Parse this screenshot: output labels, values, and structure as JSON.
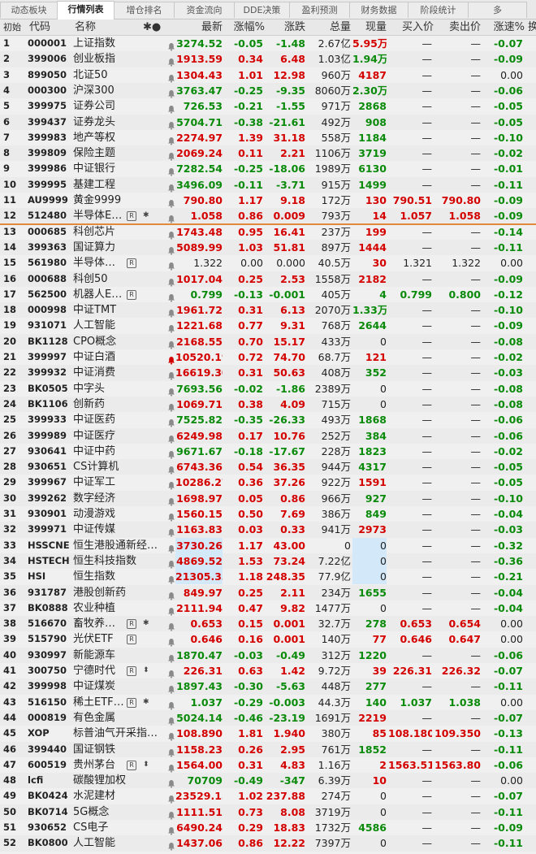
{
  "tabs": [
    "动态板块",
    "行情列表",
    "增仓排名",
    "资金流向",
    "DDE决策",
    "盈利预测",
    "财务数据",
    "阶段统计",
    "多"
  ],
  "active_tab": 1,
  "columns": [
    "初始",
    "代码",
    "名称",
    "✱●",
    "最新",
    "涨幅%",
    "涨跌",
    "总量",
    "现量",
    "买入价",
    "卖出价",
    "涨速%",
    "换"
  ],
  "colors": {
    "up": "#d40000",
    "down": "#0a8a0a",
    "separator": "#e08a3a",
    "highlight": "#d3e8f8"
  },
  "rows": [
    {
      "n": "1",
      "code": "000001",
      "name": "上证指数",
      "last": "3274.52",
      "pct": "-0.05",
      "chg": "-1.48",
      "vol": "2.67亿",
      "cur": "5.95万",
      "bid": "—",
      "ask": "—",
      "spd": "-0.07",
      "dir": "dn",
      "cur_dir": "up",
      "spd_dir": "dn"
    },
    {
      "n": "2",
      "code": "399006",
      "name": "创业板指",
      "last": "1913.59",
      "pct": "0.34",
      "chg": "6.48",
      "vol": "1.03亿",
      "cur": "1.94万",
      "bid": "—",
      "ask": "—",
      "spd": "-0.09",
      "dir": "up",
      "cur_dir": "dn",
      "spd_dir": "dn"
    },
    {
      "n": "3",
      "code": "899050",
      "name": "北证50",
      "last": "1304.43",
      "pct": "1.01",
      "chg": "12.98",
      "vol": "960万",
      "cur": "4187",
      "bid": "—",
      "ask": "—",
      "spd": "0.00",
      "dir": "up",
      "cur_dir": "up",
      "spd_dir": "flat"
    },
    {
      "n": "4",
      "code": "000300",
      "name": "沪深300",
      "last": "3763.47",
      "pct": "-0.25",
      "chg": "-9.35",
      "vol": "8060万",
      "cur": "2.30万",
      "bid": "—",
      "ask": "—",
      "spd": "-0.06",
      "dir": "dn",
      "cur_dir": "dn",
      "spd_dir": "dn"
    },
    {
      "n": "5",
      "code": "399975",
      "name": "证券公司",
      "last": "726.53",
      "pct": "-0.21",
      "chg": "-1.55",
      "vol": "971万",
      "cur": "2868",
      "bid": "—",
      "ask": "—",
      "spd": "-0.05",
      "dir": "dn",
      "cur_dir": "dn",
      "spd_dir": "dn"
    },
    {
      "n": "6",
      "code": "399437",
      "name": "证券龙头",
      "last": "5704.71",
      "pct": "-0.38",
      "chg": "-21.61",
      "vol": "492万",
      "cur": "908",
      "bid": "—",
      "ask": "—",
      "spd": "-0.05",
      "dir": "dn",
      "cur_dir": "dn",
      "spd_dir": "dn"
    },
    {
      "n": "7",
      "code": "399983",
      "name": "地产等权",
      "last": "2274.97",
      "pct": "1.39",
      "chg": "31.18",
      "vol": "558万",
      "cur": "1184",
      "bid": "—",
      "ask": "—",
      "spd": "-0.10",
      "dir": "up",
      "cur_dir": "dn",
      "spd_dir": "dn"
    },
    {
      "n": "8",
      "code": "399809",
      "name": "保险主题",
      "last": "2069.24",
      "pct": "0.11",
      "chg": "2.21",
      "vol": "1106万",
      "cur": "3719",
      "bid": "—",
      "ask": "—",
      "spd": "-0.02",
      "dir": "up",
      "cur_dir": "dn",
      "spd_dir": "dn"
    },
    {
      "n": "9",
      "code": "399986",
      "name": "中证银行",
      "last": "7282.54",
      "pct": "-0.25",
      "chg": "-18.06",
      "vol": "1989万",
      "cur": "6130",
      "bid": "—",
      "ask": "—",
      "spd": "-0.01",
      "dir": "dn",
      "cur_dir": "dn",
      "spd_dir": "dn"
    },
    {
      "n": "10",
      "code": "399995",
      "name": "基建工程",
      "last": "3496.09",
      "pct": "-0.11",
      "chg": "-3.71",
      "vol": "915万",
      "cur": "1499",
      "bid": "—",
      "ask": "—",
      "spd": "-0.11",
      "dir": "dn",
      "cur_dir": "dn",
      "spd_dir": "dn"
    },
    {
      "n": "11",
      "code": "AU9999",
      "name": "黄金9999",
      "last": "790.80",
      "pct": "1.17",
      "chg": "9.18",
      "vol": "172万",
      "cur": "130",
      "bid": "790.51",
      "ask": "790.80",
      "spd": "-0.09",
      "dir": "up",
      "cur_dir": "up",
      "spd_dir": "dn"
    },
    {
      "n": "12",
      "code": "512480",
      "name": "半导体E…",
      "last": "1.058",
      "pct": "0.86",
      "chg": "0.009",
      "vol": "793万",
      "cur": "14",
      "bid": "1.057",
      "ask": "1.058",
      "spd": "-0.09",
      "dir": "up",
      "cur_dir": "up",
      "spd_dir": "dn",
      "badge": "R",
      "mark": "✱"
    },
    {
      "n": "13",
      "code": "000685",
      "name": "科创芯片",
      "last": "1743.48",
      "pct": "0.95",
      "chg": "16.41",
      "vol": "237万",
      "cur": "199",
      "bid": "—",
      "ask": "—",
      "spd": "-0.14",
      "dir": "up",
      "cur_dir": "up",
      "spd_dir": "dn"
    },
    {
      "n": "14",
      "code": "399363",
      "name": "国证算力",
      "last": "5089.99",
      "pct": "1.03",
      "chg": "51.81",
      "vol": "897万",
      "cur": "1444",
      "bid": "—",
      "ask": "—",
      "spd": "-0.11",
      "dir": "up",
      "cur_dir": "up",
      "spd_dir": "dn"
    },
    {
      "n": "15",
      "code": "561980",
      "name": "半导体…",
      "last": "1.322",
      "pct": "0.00",
      "chg": "0.000",
      "vol": "40.5万",
      "cur": "30",
      "bid": "1.321",
      "ask": "1.322",
      "spd": "0.00",
      "dir": "flat",
      "cur_dir": "up",
      "spd_dir": "flat",
      "badge": "R"
    },
    {
      "n": "16",
      "code": "000688",
      "name": "科创50",
      "last": "1017.04",
      "pct": "0.25",
      "chg": "2.53",
      "vol": "1558万",
      "cur": "2182",
      "bid": "—",
      "ask": "—",
      "spd": "-0.09",
      "dir": "up",
      "cur_dir": "up",
      "spd_dir": "dn"
    },
    {
      "n": "17",
      "code": "562500",
      "name": "机器人E…",
      "last": "0.799",
      "pct": "-0.13",
      "chg": "-0.001",
      "vol": "405万",
      "cur": "4",
      "bid": "0.799",
      "ask": "0.800",
      "spd": "-0.12",
      "dir": "dn",
      "cur_dir": "dn",
      "spd_dir": "dn",
      "badge": "R"
    },
    {
      "n": "18",
      "code": "000998",
      "name": "中证TMT",
      "last": "1961.72",
      "pct": "0.31",
      "chg": "6.13",
      "vol": "2070万",
      "cur": "1.33万",
      "bid": "—",
      "ask": "—",
      "spd": "-0.10",
      "dir": "up",
      "cur_dir": "dn",
      "spd_dir": "dn"
    },
    {
      "n": "19",
      "code": "931071",
      "name": "人工智能",
      "last": "1221.68",
      "pct": "0.77",
      "chg": "9.31",
      "vol": "768万",
      "cur": "2644",
      "bid": "—",
      "ask": "—",
      "spd": "-0.09",
      "dir": "up",
      "cur_dir": "dn",
      "spd_dir": "dn"
    },
    {
      "n": "20",
      "code": "BK1128",
      "name": "CPO概念",
      "last": "2168.55",
      "pct": "0.70",
      "chg": "15.17",
      "vol": "433万",
      "cur": "0",
      "bid": "—",
      "ask": "—",
      "spd": "-0.08",
      "dir": "up",
      "cur_dir": "flat",
      "spd_dir": "dn"
    },
    {
      "n": "21",
      "code": "399997",
      "name": "中证白酒",
      "last": "10520.19",
      "pct": "0.72",
      "chg": "74.70",
      "vol": "68.7万",
      "cur": "121",
      "bid": "—",
      "ask": "—",
      "spd": "-0.02",
      "dir": "up",
      "cur_dir": "up",
      "spd_dir": "dn",
      "bell_red": true
    },
    {
      "n": "22",
      "code": "399932",
      "name": "中证消费",
      "last": "16619.30",
      "pct": "0.31",
      "chg": "50.63",
      "vol": "408万",
      "cur": "352",
      "bid": "—",
      "ask": "—",
      "spd": "-0.03",
      "dir": "up",
      "cur_dir": "dn",
      "spd_dir": "dn"
    },
    {
      "n": "23",
      "code": "BK0505",
      "name": "中字头",
      "last": "7693.56",
      "pct": "-0.02",
      "chg": "-1.86",
      "vol": "2389万",
      "cur": "0",
      "bid": "—",
      "ask": "—",
      "spd": "-0.08",
      "dir": "dn",
      "cur_dir": "flat",
      "spd_dir": "dn"
    },
    {
      "n": "24",
      "code": "BK1106",
      "name": "创新药",
      "last": "1069.71",
      "pct": "0.38",
      "chg": "4.09",
      "vol": "715万",
      "cur": "0",
      "bid": "—",
      "ask": "—",
      "spd": "-0.08",
      "dir": "up",
      "cur_dir": "flat",
      "spd_dir": "dn"
    },
    {
      "n": "25",
      "code": "399933",
      "name": "中证医药",
      "last": "7525.82",
      "pct": "-0.35",
      "chg": "-26.33",
      "vol": "493万",
      "cur": "1868",
      "bid": "—",
      "ask": "—",
      "spd": "-0.06",
      "dir": "dn",
      "cur_dir": "dn",
      "spd_dir": "dn"
    },
    {
      "n": "26",
      "code": "399989",
      "name": "中证医疗",
      "last": "6249.98",
      "pct": "0.17",
      "chg": "10.76",
      "vol": "252万",
      "cur": "384",
      "bid": "—",
      "ask": "—",
      "spd": "-0.06",
      "dir": "up",
      "cur_dir": "dn",
      "spd_dir": "dn"
    },
    {
      "n": "27",
      "code": "930641",
      "name": "中证中药",
      "last": "9671.67",
      "pct": "-0.18",
      "chg": "-17.67",
      "vol": "228万",
      "cur": "1823",
      "bid": "—",
      "ask": "—",
      "spd": "-0.02",
      "dir": "dn",
      "cur_dir": "dn",
      "spd_dir": "dn"
    },
    {
      "n": "28",
      "code": "930651",
      "name": "CS计算机",
      "last": "6743.36",
      "pct": "0.54",
      "chg": "36.35",
      "vol": "944万",
      "cur": "4317",
      "bid": "—",
      "ask": "—",
      "spd": "-0.05",
      "dir": "up",
      "cur_dir": "dn",
      "spd_dir": "dn"
    },
    {
      "n": "29",
      "code": "399967",
      "name": "中证军工",
      "last": "10286.27",
      "pct": "0.36",
      "chg": "37.26",
      "vol": "922万",
      "cur": "1591",
      "bid": "—",
      "ask": "—",
      "spd": "-0.05",
      "dir": "up",
      "cur_dir": "up",
      "spd_dir": "dn"
    },
    {
      "n": "30",
      "code": "399262",
      "name": "数字经济",
      "last": "1698.97",
      "pct": "0.05",
      "chg": "0.86",
      "vol": "966万",
      "cur": "927",
      "bid": "—",
      "ask": "—",
      "spd": "-0.10",
      "dir": "up",
      "cur_dir": "dn",
      "spd_dir": "dn"
    },
    {
      "n": "31",
      "code": "930901",
      "name": "动漫游戏",
      "last": "1560.15",
      "pct": "0.50",
      "chg": "7.69",
      "vol": "386万",
      "cur": "849",
      "bid": "—",
      "ask": "—",
      "spd": "-0.04",
      "dir": "up",
      "cur_dir": "dn",
      "spd_dir": "dn"
    },
    {
      "n": "32",
      "code": "399971",
      "name": "中证传媒",
      "last": "1163.83",
      "pct": "0.03",
      "chg": "0.33",
      "vol": "941万",
      "cur": "2973",
      "bid": "—",
      "ask": "—",
      "spd": "-0.03",
      "dir": "up",
      "cur_dir": "up",
      "spd_dir": "dn"
    },
    {
      "n": "33",
      "code": "HSSCNE",
      "name": "恒生港股通新经…",
      "last": "3730.26",
      "pct": "1.17",
      "chg": "43.00",
      "vol": "0",
      "cur": "0",
      "bid": "—",
      "ask": "—",
      "spd": "-0.32",
      "dir": "up",
      "cur_dir": "flat",
      "spd_dir": "dn",
      "hl": true
    },
    {
      "n": "34",
      "code": "HSTECH",
      "name": "恒生科技指数",
      "last": "4869.52",
      "pct": "1.53",
      "chg": "73.24",
      "vol": "7.22亿",
      "cur": "0",
      "bid": "—",
      "ask": "—",
      "spd": "-0.36",
      "dir": "up",
      "cur_dir": "flat",
      "spd_dir": "dn",
      "hl": true
    },
    {
      "n": "35",
      "code": "HSI",
      "name": "恒生指数",
      "last": "21305.33",
      "pct": "1.18",
      "chg": "248.35",
      "vol": "77.9亿",
      "cur": "0",
      "bid": "—",
      "ask": "—",
      "spd": "-0.21",
      "dir": "up",
      "cur_dir": "flat",
      "spd_dir": "dn",
      "hl": true
    },
    {
      "n": "36",
      "code": "931787",
      "name": "港股创新药",
      "last": "849.97",
      "pct": "0.25",
      "chg": "2.11",
      "vol": "234万",
      "cur": "1655",
      "bid": "—",
      "ask": "—",
      "spd": "-0.04",
      "dir": "up",
      "cur_dir": "dn",
      "spd_dir": "dn"
    },
    {
      "n": "37",
      "code": "BK0888",
      "name": "农业种植",
      "last": "2111.94",
      "pct": "0.47",
      "chg": "9.82",
      "vol": "1477万",
      "cur": "0",
      "bid": "—",
      "ask": "—",
      "spd": "-0.04",
      "dir": "up",
      "cur_dir": "flat",
      "spd_dir": "dn"
    },
    {
      "n": "38",
      "code": "516670",
      "name": "畜牧养…",
      "last": "0.653",
      "pct": "0.15",
      "chg": "0.001",
      "vol": "32.7万",
      "cur": "278",
      "bid": "0.653",
      "ask": "0.654",
      "spd": "0.00",
      "dir": "up",
      "cur_dir": "dn",
      "spd_dir": "flat",
      "badge": "R",
      "mark": "✱"
    },
    {
      "n": "39",
      "code": "515790",
      "name": "光伏ETF",
      "last": "0.646",
      "pct": "0.16",
      "chg": "0.001",
      "vol": "140万",
      "cur": "77",
      "bid": "0.646",
      "ask": "0.647",
      "spd": "0.00",
      "dir": "up",
      "cur_dir": "up",
      "spd_dir": "flat",
      "badge": "R"
    },
    {
      "n": "40",
      "code": "930997",
      "name": "新能源车",
      "last": "1870.47",
      "pct": "-0.03",
      "chg": "-0.49",
      "vol": "312万",
      "cur": "1220",
      "bid": "—",
      "ask": "—",
      "spd": "-0.06",
      "dir": "dn",
      "cur_dir": "dn",
      "spd_dir": "dn"
    },
    {
      "n": "41",
      "code": "300750",
      "name": "宁德时代",
      "last": "226.31",
      "pct": "0.63",
      "chg": "1.42",
      "vol": "9.72万",
      "cur": "39",
      "bid": "226.31",
      "ask": "226.32",
      "spd": "-0.07",
      "dir": "up",
      "cur_dir": "up",
      "spd_dir": "dn",
      "badge": "R",
      "mark": "⬍"
    },
    {
      "n": "42",
      "code": "399998",
      "name": "中证煤炭",
      "last": "1897.43",
      "pct": "-0.30",
      "chg": "-5.63",
      "vol": "448万",
      "cur": "277",
      "bid": "—",
      "ask": "—",
      "spd": "-0.11",
      "dir": "dn",
      "cur_dir": "dn",
      "spd_dir": "dn"
    },
    {
      "n": "43",
      "code": "516150",
      "name": "稀土ETF…",
      "last": "1.037",
      "pct": "-0.29",
      "chg": "-0.003",
      "vol": "44.3万",
      "cur": "140",
      "bid": "1.037",
      "ask": "1.038",
      "spd": "0.00",
      "dir": "dn",
      "cur_dir": "dn",
      "spd_dir": "flat",
      "badge": "R",
      "mark": "✱"
    },
    {
      "n": "44",
      "code": "000819",
      "name": "有色金属",
      "last": "5024.14",
      "pct": "-0.46",
      "chg": "-23.19",
      "vol": "1691万",
      "cur": "2219",
      "bid": "—",
      "ask": "—",
      "spd": "-0.07",
      "dir": "dn",
      "cur_dir": "up",
      "spd_dir": "dn"
    },
    {
      "n": "45",
      "code": "XOP",
      "name": "标普油气开采指…",
      "last": "108.890",
      "pct": "1.81",
      "chg": "1.940",
      "vol": "380万",
      "cur": "85",
      "bid": "108.180",
      "ask": "109.350",
      "spd": "-0.13",
      "dir": "up",
      "cur_dir": "up",
      "spd_dir": "dn"
    },
    {
      "n": "46",
      "code": "399440",
      "name": "国证钢铁",
      "last": "1158.23",
      "pct": "0.26",
      "chg": "2.95",
      "vol": "761万",
      "cur": "1852",
      "bid": "—",
      "ask": "—",
      "spd": "-0.11",
      "dir": "up",
      "cur_dir": "dn",
      "spd_dir": "dn"
    },
    {
      "n": "47",
      "code": "600519",
      "name": "贵州茅台",
      "last": "1564.00",
      "pct": "0.31",
      "chg": "4.83",
      "vol": "1.16万",
      "cur": "2",
      "bid": "1563.51",
      "ask": "1563.80",
      "spd": "-0.06",
      "dir": "up",
      "cur_dir": "up",
      "spd_dir": "dn",
      "badge": "R",
      "mark": "⬍"
    },
    {
      "n": "48",
      "code": "lcfi",
      "name": "碳酸锂加权",
      "last": "70709",
      "pct": "-0.49",
      "chg": "-347",
      "vol": "6.39万",
      "cur": "10",
      "bid": "—",
      "ask": "—",
      "spd": "0.00",
      "dir": "dn",
      "cur_dir": "up",
      "spd_dir": "flat"
    },
    {
      "n": "49",
      "code": "BK0424",
      "name": "水泥建材",
      "last": "23529.15",
      "pct": "1.02",
      "chg": "237.88",
      "vol": "274万",
      "cur": "0",
      "bid": "—",
      "ask": "—",
      "spd": "-0.07",
      "dir": "up",
      "cur_dir": "flat",
      "spd_dir": "dn"
    },
    {
      "n": "50",
      "code": "BK0714",
      "name": "5G概念",
      "last": "1111.51",
      "pct": "0.73",
      "chg": "8.08",
      "vol": "3719万",
      "cur": "0",
      "bid": "—",
      "ask": "—",
      "spd": "-0.11",
      "dir": "up",
      "cur_dir": "flat",
      "spd_dir": "dn"
    },
    {
      "n": "51",
      "code": "930652",
      "name": "CS电子",
      "last": "6490.24",
      "pct": "0.29",
      "chg": "18.83",
      "vol": "1732万",
      "cur": "4586",
      "bid": "—",
      "ask": "—",
      "spd": "-0.09",
      "dir": "up",
      "cur_dir": "dn",
      "spd_dir": "dn"
    },
    {
      "n": "52",
      "code": "BK0800",
      "name": "人工智能",
      "last": "1437.06",
      "pct": "0.86",
      "chg": "12.22",
      "vol": "7397万",
      "cur": "0",
      "bid": "—",
      "ask": "—",
      "spd": "-0.11",
      "dir": "up",
      "cur_dir": "flat",
      "spd_dir": "dn"
    }
  ]
}
